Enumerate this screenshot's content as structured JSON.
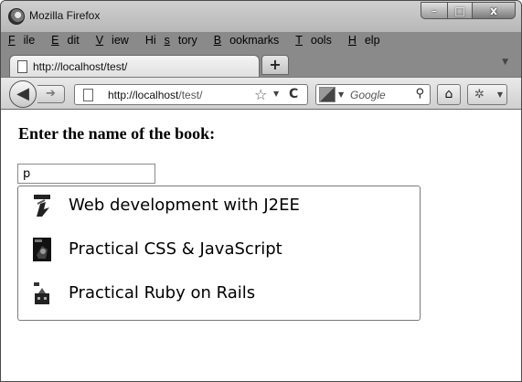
{
  "window": {
    "title": "Mozilla Firefox",
    "controls": {
      "minimize": "–",
      "maximize": "□",
      "close": "x"
    }
  },
  "menubar": {
    "items": [
      {
        "accel": "F",
        "rest": "ile"
      },
      {
        "accel": "E",
        "rest": "dit"
      },
      {
        "accel": "V",
        "rest": "iew"
      },
      {
        "pre": "Hi",
        "accel": "s",
        "rest": "tory"
      },
      {
        "accel": "B",
        "rest": "ookmarks"
      },
      {
        "accel": "T",
        "rest": "ools"
      },
      {
        "accel": "H",
        "rest": "elp"
      }
    ]
  },
  "tabs": [
    {
      "label": "http://localhost/test/"
    }
  ],
  "new_tab_label": "+",
  "navbar": {
    "url_host": "http://localhost",
    "url_path": "/test/",
    "search_placeholder": "Google",
    "back_glyph": "◀",
    "forward_glyph": "➔",
    "star_glyph": "☆",
    "reload_glyph": "C",
    "search_glyph": "⚲",
    "home_glyph": "⌂",
    "addon_glyph": "✲"
  },
  "page": {
    "heading": "Enter the name of the book:",
    "input_value": "p",
    "suggestions": [
      {
        "label": "Web development with J2EE",
        "icon": "book-cover-j2ee-icon"
      },
      {
        "label": "Practical CSS & JavaScript",
        "icon": "book-cover-css-icon"
      },
      {
        "label": "Practical Ruby on Rails",
        "icon": "book-cover-rails-icon"
      }
    ]
  }
}
